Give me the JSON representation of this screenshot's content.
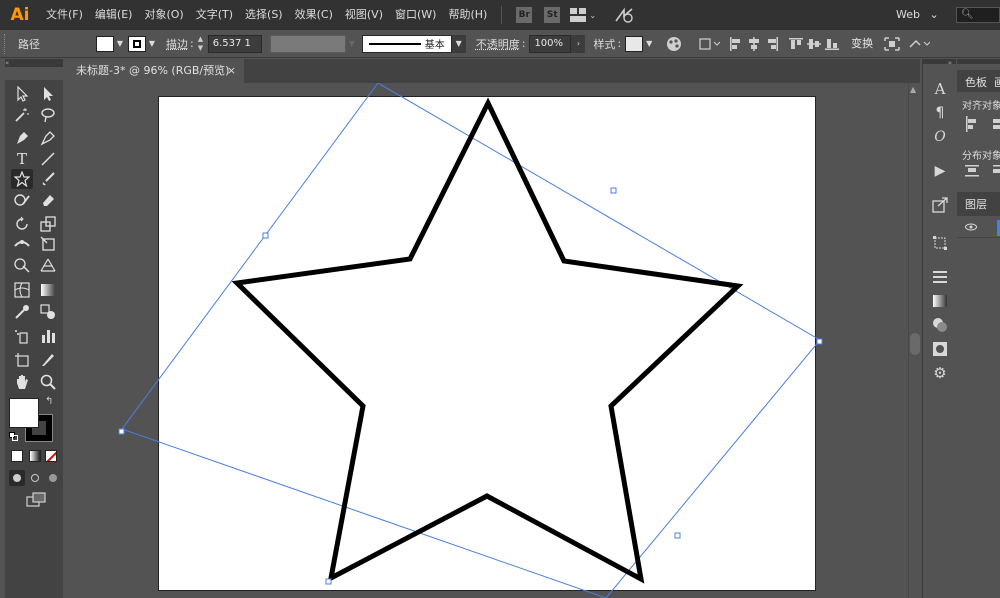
{
  "app": {
    "logo": "Ai"
  },
  "menu": {
    "items": [
      "文件(F)",
      "编辑(E)",
      "对象(O)",
      "文字(T)",
      "选择(S)",
      "效果(C)",
      "视图(V)",
      "窗口(W)",
      "帮助(H)"
    ],
    "bridge_badge": "Br",
    "stock_badge": "St",
    "workspace": "Web",
    "workspace_arrow": "⌄"
  },
  "controlbar": {
    "selection_label": "路径",
    "stroke_label": "描边",
    "stroke_weight": "6.537 1",
    "brush_label": "基本",
    "opacity_label": "不透明度",
    "opacity_value": "100%",
    "style_label": "样式",
    "transform_label": "变换",
    "fill_color": "#ffffff",
    "stroke_color": "#000000"
  },
  "document": {
    "tab_title": "未标题-3* @ 96% (RGB/预览)",
    "close_glyph": "×"
  },
  "right_panels": {
    "color_tab": "色板",
    "other_tab": "画",
    "align_objects": "对齐对象",
    "distribute_objects": "分布对象",
    "layers_tab": "图层"
  },
  "tools": {
    "color_fill": "#ffffff",
    "color_stroke": "#000000"
  },
  "colors": {
    "app_bg": "#535353",
    "menubar_bg": "#323232",
    "selection_blue": "#4a7fe0",
    "logo_orange": "#ff9a00"
  }
}
